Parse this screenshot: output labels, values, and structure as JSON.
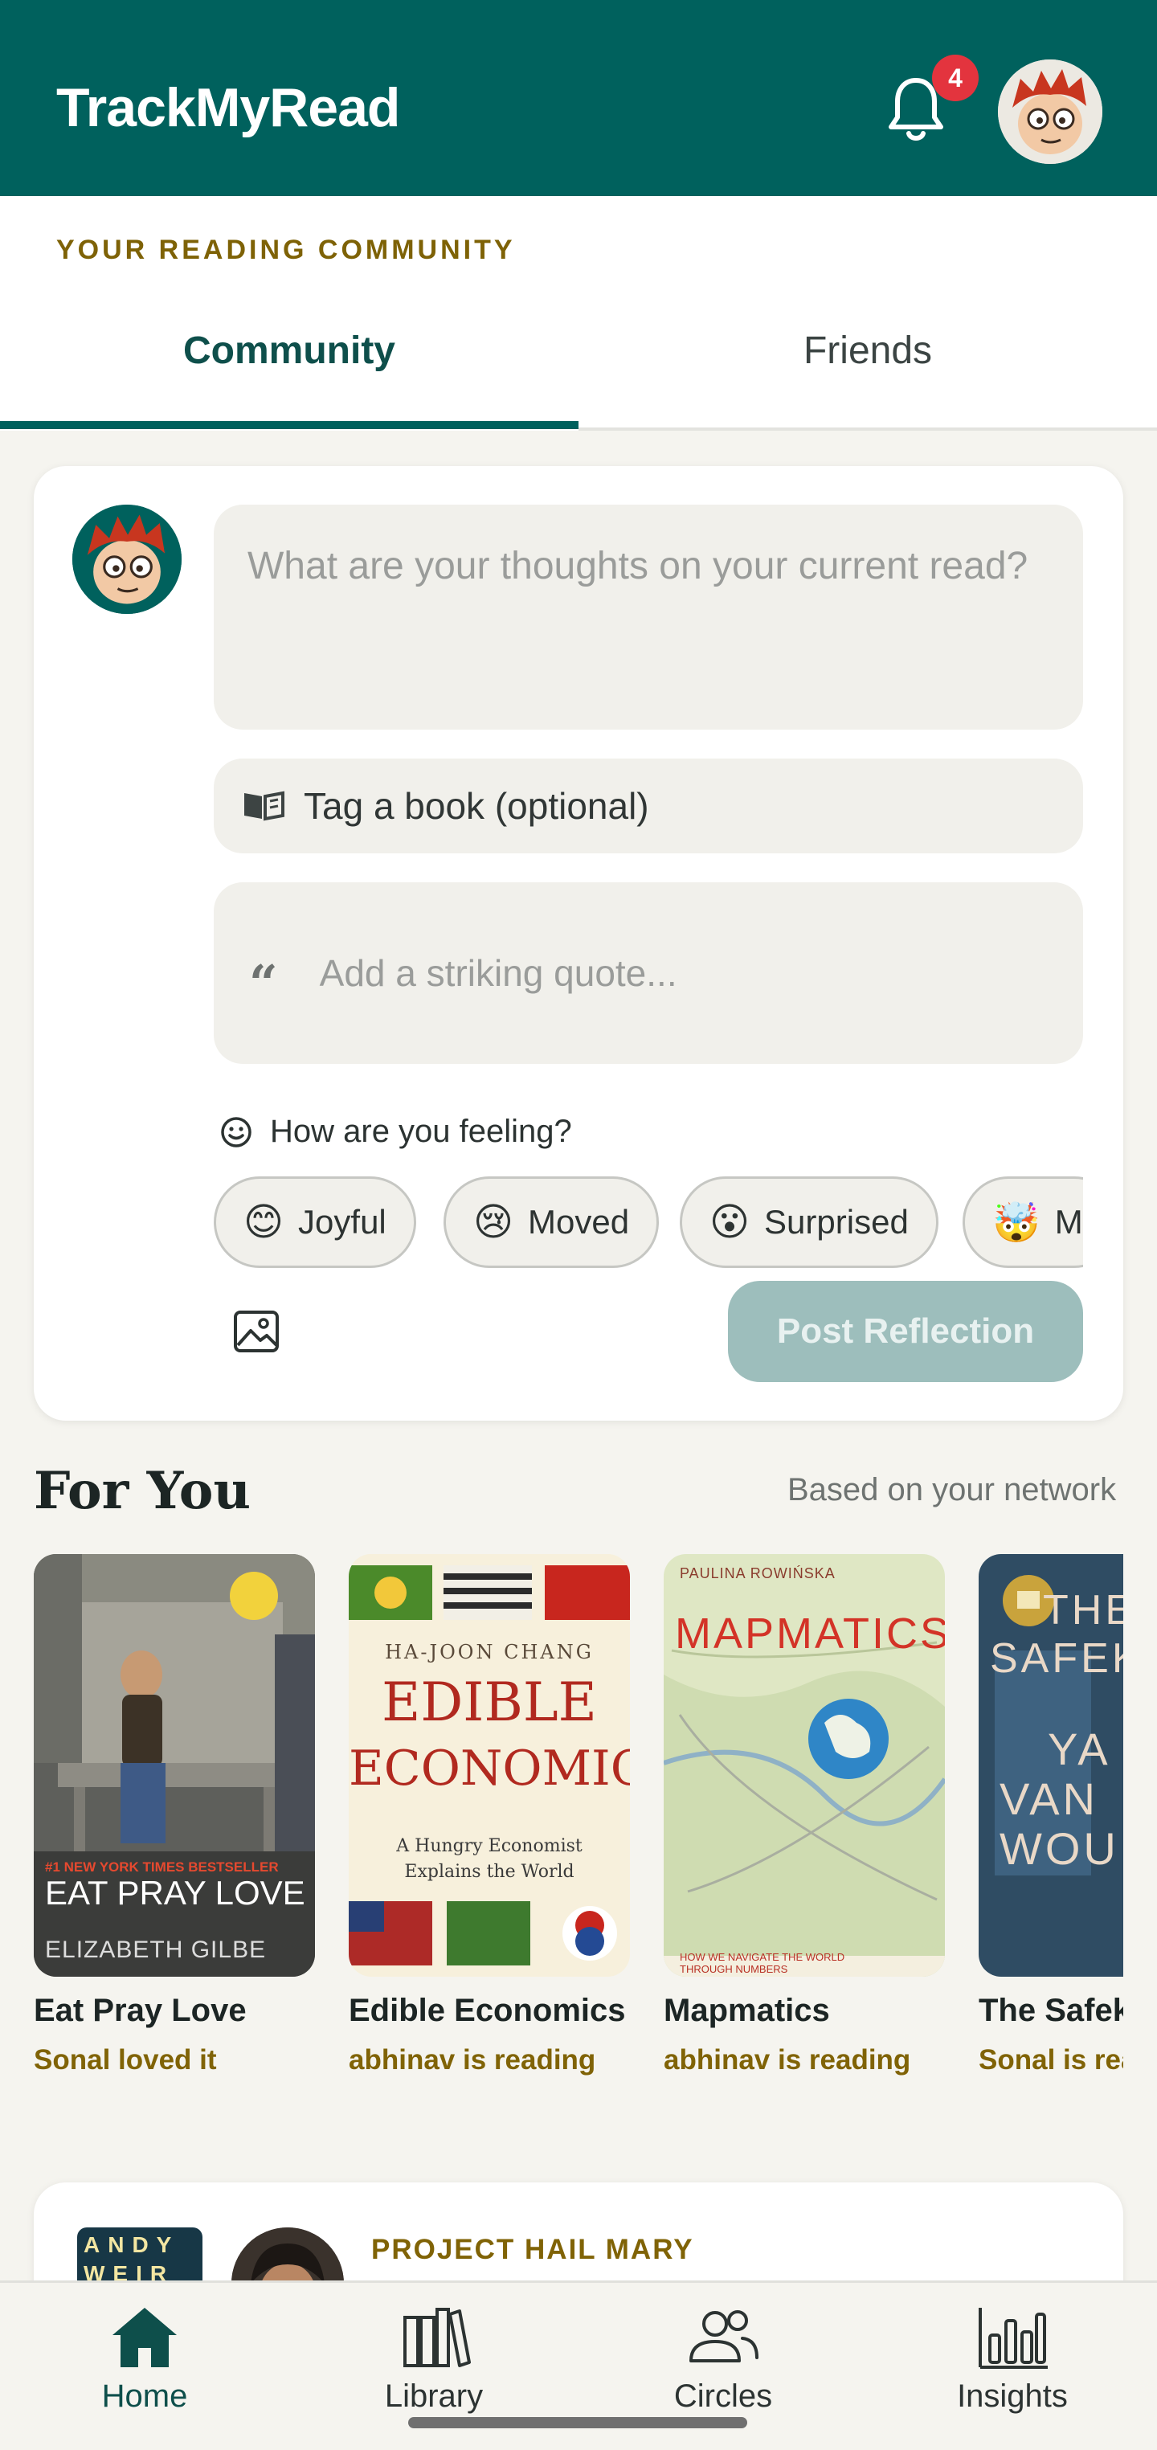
{
  "header": {
    "brand": "TrackMyRead",
    "notification_count": "4"
  },
  "community_label": "YOUR READING COMMUNITY",
  "tabs": [
    {
      "label": "Community",
      "active": true
    },
    {
      "label": "Friends",
      "active": false
    }
  ],
  "composer": {
    "thoughts_placeholder": "What are your thoughts on your current read?",
    "tag_book_label": "Tag a book (optional)",
    "quote_placeholder": "Add a striking quote...",
    "feeling_label": "How are you feeling?",
    "moods": [
      {
        "emoji": "😊",
        "label": "Joyful"
      },
      {
        "emoji": "😢",
        "label": "Moved"
      },
      {
        "emoji": "😮",
        "label": "Surprised"
      },
      {
        "emoji": "🤯",
        "label": "Mi"
      }
    ],
    "post_button": "Post Reflection"
  },
  "for_you": {
    "title": "For You",
    "subtitle": "Based on your network",
    "books": [
      {
        "title": "Eat Pray Love",
        "meta": "Sonal loved it",
        "cover_top": "#1 NEW YORK TIMES BESTSELLER",
        "cover_main": "EAT PRAY LOVE",
        "cover_author": "ELIZABETH GILBE"
      },
      {
        "title": "Edible Economics",
        "meta": "abhinav is reading",
        "cover_author": "HA-JOON CHANG",
        "cover_main_1": "EDIBLE",
        "cover_main_2": "ECONOMICS",
        "cover_sub": "A Hungry Economist Explains the World"
      },
      {
        "title": "Mapmatics",
        "meta": "abhinav is reading",
        "cover_author": "PAULINA ROWIŃSKA",
        "cover_main": "MAPMATICS",
        "cover_sub": "HOW WE NAVIGATE THE WORLD THROUGH NUMBERS"
      },
      {
        "title": "The Safek",
        "meta": "Sonal is rea",
        "cover_main_1": "THE",
        "cover_main_2": "SAFEK",
        "cover_main_3": "YA",
        "cover_main_4": "VAN",
        "cover_main_5": "WOU"
      }
    ]
  },
  "feed": {
    "book_label": "PROJECT HAIL MARY",
    "cover_line_1": "ANDY",
    "cover_line_2": "WEIR"
  },
  "bottom_nav": [
    {
      "label": "Home",
      "icon": "home-icon",
      "active": true
    },
    {
      "label": "Library",
      "icon": "library-icon",
      "active": false
    },
    {
      "label": "Circles",
      "icon": "people-icon",
      "active": false
    },
    {
      "label": "Insights",
      "icon": "bar-chart-icon",
      "active": false
    }
  ],
  "colors": {
    "primary": "#00615d",
    "accent_gold": "#806306",
    "badge_red": "#e3343e",
    "post_disabled": "#9dbebc"
  }
}
